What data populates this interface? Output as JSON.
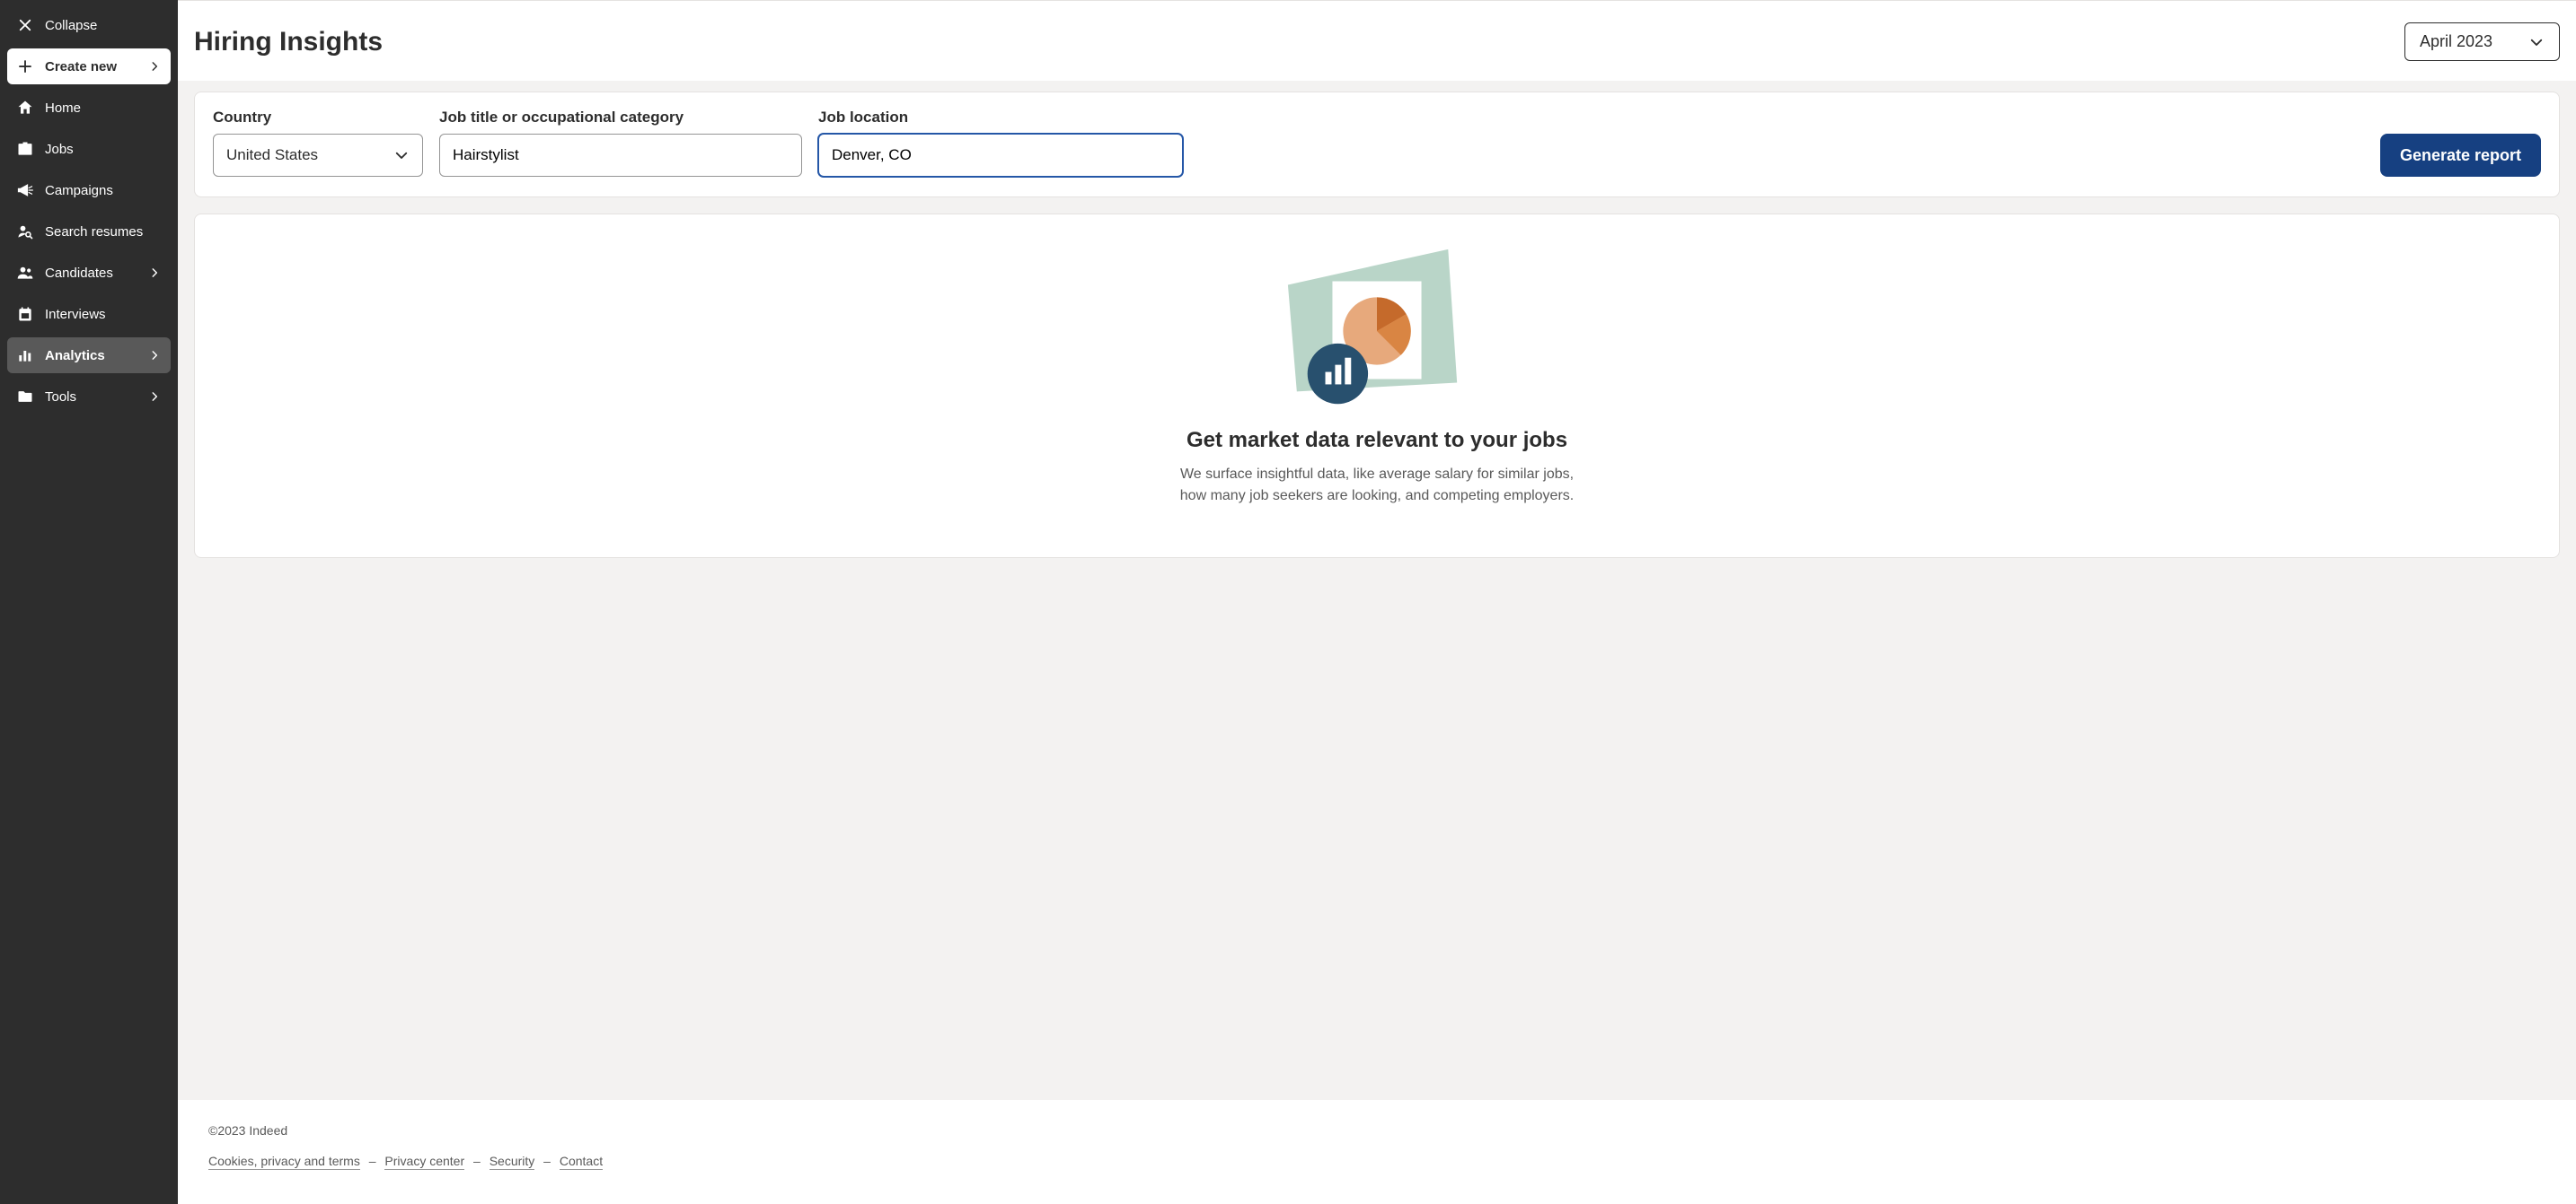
{
  "sidebar": {
    "collapse": "Collapse",
    "create": "Create new",
    "items": [
      {
        "label": "Home"
      },
      {
        "label": "Jobs"
      },
      {
        "label": "Campaigns"
      },
      {
        "label": "Search resumes"
      },
      {
        "label": "Candidates"
      },
      {
        "label": "Interviews"
      },
      {
        "label": "Analytics"
      },
      {
        "label": "Tools"
      }
    ]
  },
  "header": {
    "title": "Hiring Insights",
    "month": "April 2023"
  },
  "filters": {
    "country_label": "Country",
    "country_value": "United States",
    "title_label": "Job title or occupational category",
    "title_value": "Hairstylist",
    "loc_label": "Job location",
    "loc_value": "Denver, CO",
    "button": "Generate report"
  },
  "empty": {
    "title": "Get market data relevant to your jobs",
    "text": "We surface insightful data, like average salary for similar jobs, how many job seekers are looking, and competing employers."
  },
  "footer": {
    "copyright": "©2023 Indeed",
    "links": {
      "cookies": "Cookies, privacy and terms",
      "privacy": "Privacy center",
      "security": "Security",
      "contact": "Contact"
    }
  }
}
